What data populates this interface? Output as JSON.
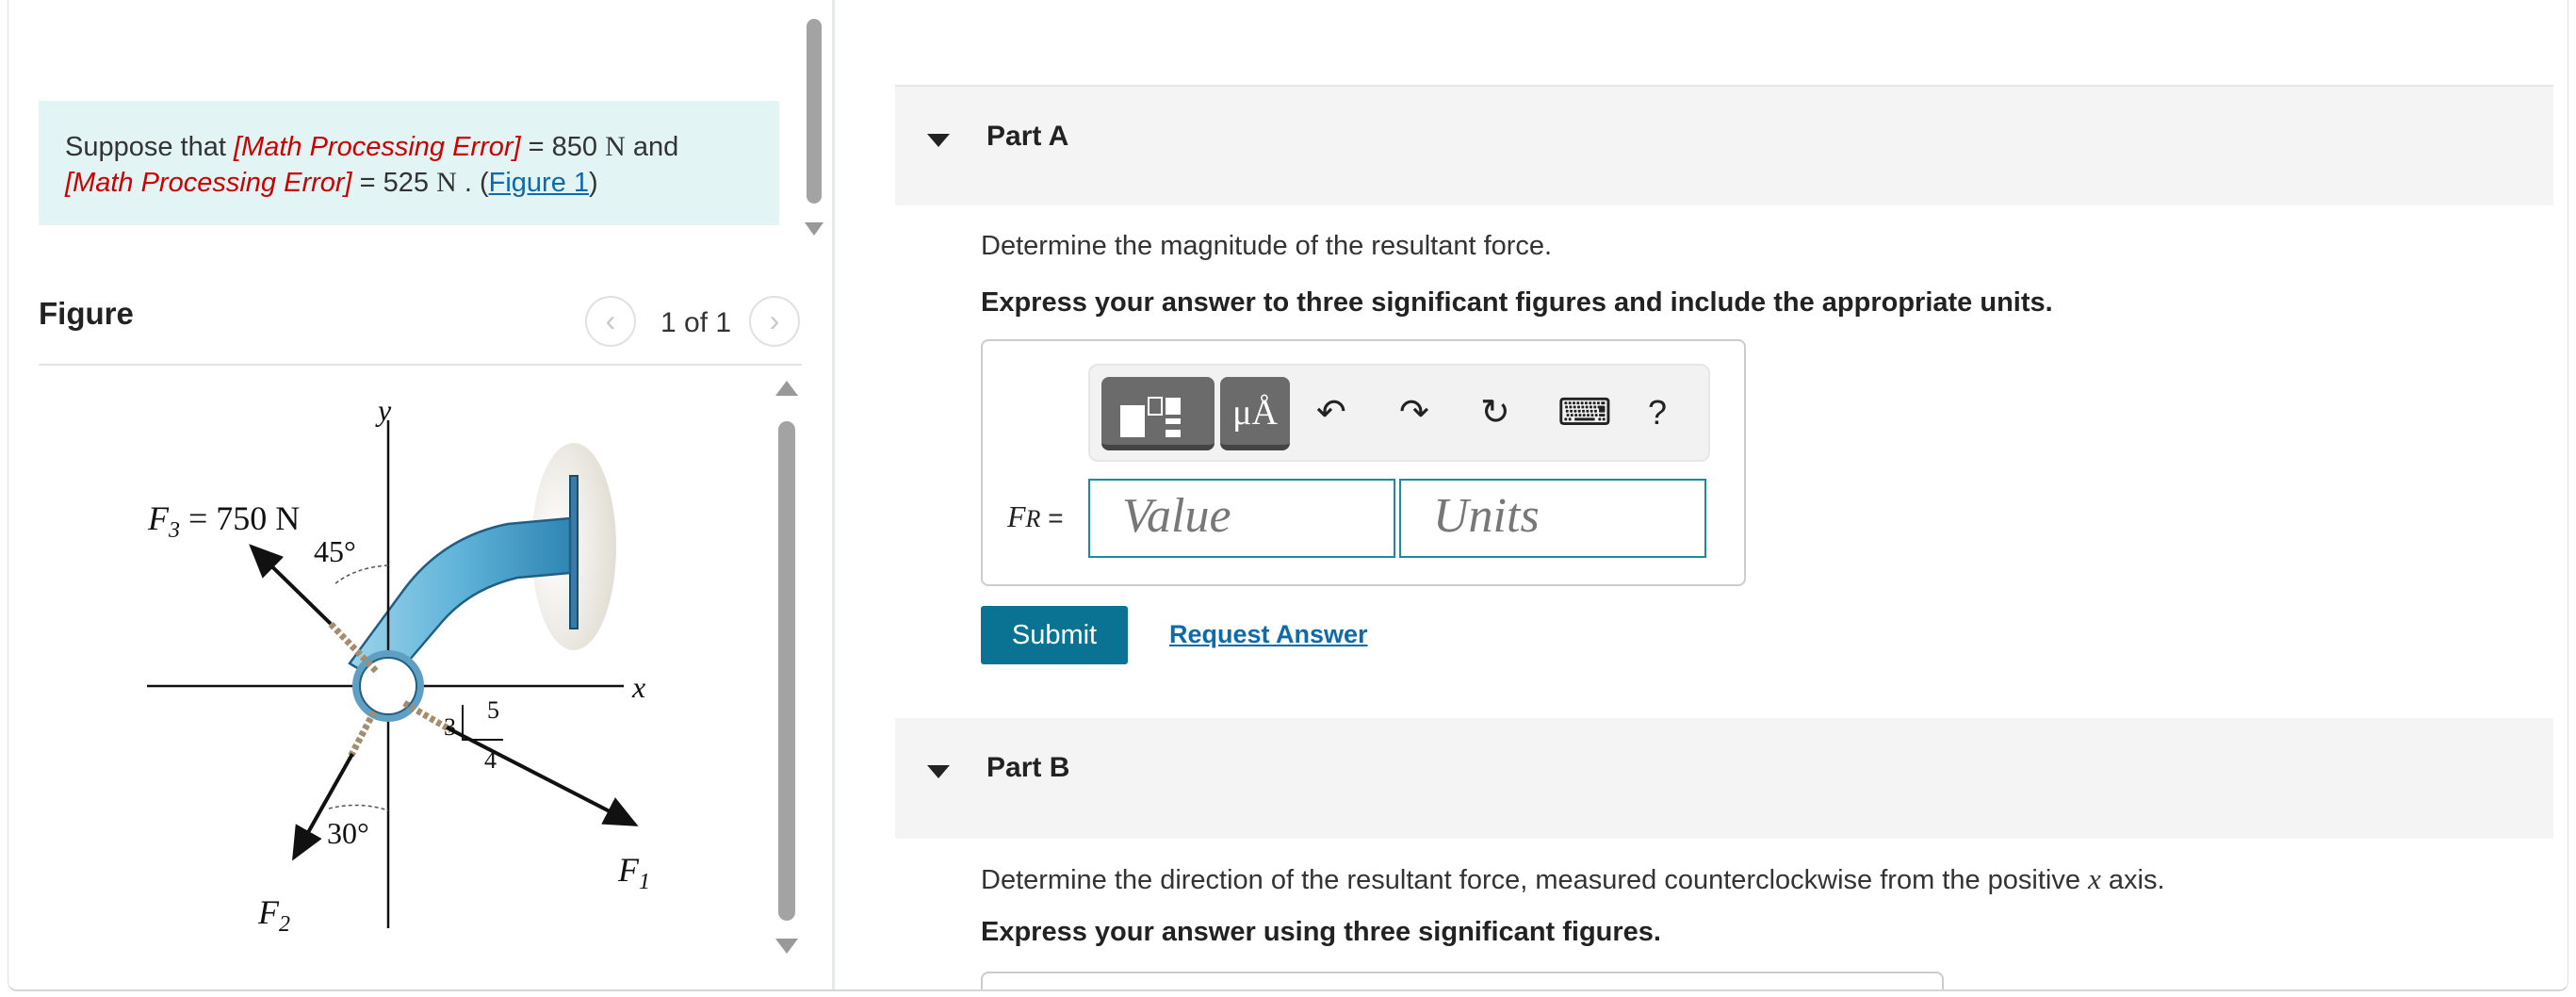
{
  "problem": {
    "intro": "Suppose that ",
    "error1": "[Math Processing Error]",
    "eq1": " = 850 ",
    "unit1": "N",
    "and": " and",
    "error2": "[Math Processing Error]",
    "eq2": " = 525 ",
    "unit2": "N",
    "tail": " . (",
    "figure_link": "Figure 1",
    "close": ")"
  },
  "figure": {
    "header": "Figure",
    "pager": "1 of 1",
    "prev_icon": "chevron-left-icon",
    "next_icon": "chevron-right-icon",
    "labels": {
      "y": "y",
      "x": "x",
      "f3": "F",
      "f3_sub": "3",
      "f3_val": " = 750 N",
      "angle45": "45°",
      "angle30": "30°",
      "f1": "F",
      "f1_sub": "1",
      "f2": "F",
      "f2_sub": "2",
      "tri5": "5",
      "tri4": "4",
      "tri3": "3"
    }
  },
  "partA": {
    "title": "Part A",
    "question": "Determine the magnitude of the resultant force.",
    "instruction": "Express your answer to three significant figures and include the appropriate units.",
    "label_main": "F",
    "label_sub": "R",
    "label_eq": " =",
    "value_placeholder": "Value",
    "units_placeholder": "Units",
    "toolbar": {
      "undo": "↶",
      "redo": "↷",
      "reset": "↻",
      "keyboard": "⌨",
      "help": "?",
      "units_tile": "μÅ"
    },
    "submit": "Submit",
    "request": "Request Answer"
  },
  "partB": {
    "title": "Part B",
    "question_pre": "Determine the direction of the resultant force, measured counterclockwise from the positive ",
    "question_var": "x",
    "question_post": " axis.",
    "instruction": "Express your answer using three significant figures."
  }
}
